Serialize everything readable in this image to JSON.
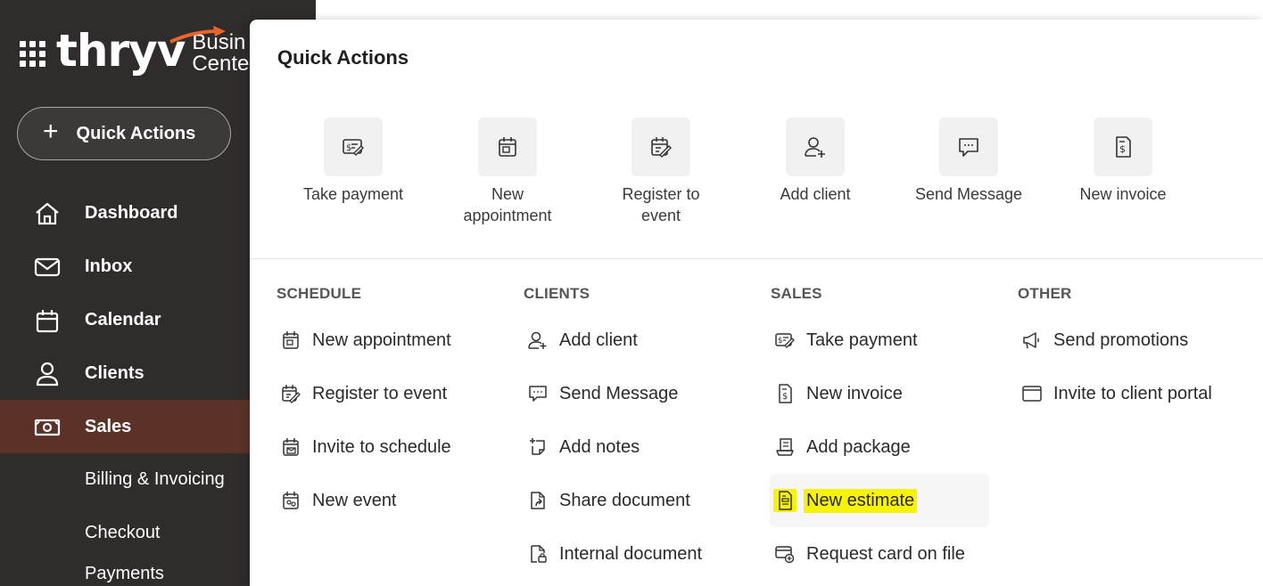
{
  "app": {
    "logo_text": "thryv",
    "logo_sub": [
      "Busin",
      "Cente"
    ],
    "quick_actions_button": "Quick Actions"
  },
  "nav": [
    {
      "label": "Dashboard",
      "icon": "home-icon"
    },
    {
      "label": "Inbox",
      "icon": "mail-icon"
    },
    {
      "label": "Calendar",
      "icon": "calendar-icon"
    },
    {
      "label": "Clients",
      "icon": "user-icon"
    },
    {
      "label": "Sales",
      "icon": "cash-icon",
      "active": true
    }
  ],
  "sales_sub": [
    "Billing & Invoicing",
    "Checkout",
    "Payments"
  ],
  "panel": {
    "title": "Quick Actions",
    "tiles": [
      {
        "label": "Take payment",
        "icon": "payment-icon"
      },
      {
        "label": "New appointment",
        "icon": "calendar-icon"
      },
      {
        "label": "Register to event",
        "icon": "register-event-icon"
      },
      {
        "label": "Add client",
        "icon": "add-user-icon"
      },
      {
        "label": "Send Message",
        "icon": "message-icon"
      },
      {
        "label": "New invoice",
        "icon": "invoice-icon"
      }
    ],
    "columns": [
      {
        "heading": "SCHEDULE",
        "items": [
          "New appointment",
          "Register to event",
          "Invite to schedule",
          "New event"
        ]
      },
      {
        "heading": "CLIENTS",
        "items": [
          "Add client",
          "Send Message",
          "Add notes",
          "Share document",
          "Internal document"
        ]
      },
      {
        "heading": "SALES",
        "items": [
          "Take payment",
          "New invoice",
          "Add package",
          "New estimate",
          "Request card on file"
        ]
      },
      {
        "heading": "OTHER",
        "items": [
          "Send promotions",
          "Invite to client portal"
        ]
      }
    ]
  },
  "colors": {
    "sidebar_bg": "#302c2b",
    "sidebar_active": "#5c3228",
    "brand_accent": "#e8652c",
    "highlight": "#f6f20a"
  }
}
